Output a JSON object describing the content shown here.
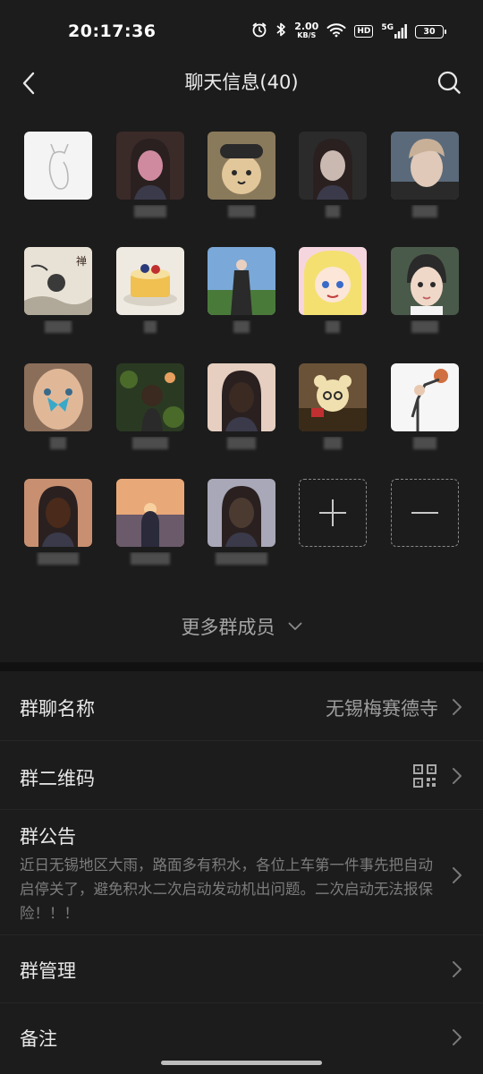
{
  "status_bar": {
    "time": "20:17:36",
    "net_speed_value": "2.00",
    "net_speed_unit": "KB/S",
    "hd_label": "HD",
    "network_label": "5G",
    "battery_level": "30",
    "icons": [
      "alarm-icon",
      "bluetooth-icon",
      "wifi-icon",
      "signal-icon",
      "battery-icon"
    ]
  },
  "header": {
    "title": "聊天信息(40)",
    "back_icon": "back-arrow-icon",
    "search_icon": "search-icon"
  },
  "members": {
    "count": 40,
    "items": [
      {
        "id": "m1",
        "bg": "#f4f4f4",
        "fg": "#b8b8b8",
        "kind": "cat-line"
      },
      {
        "id": "m2",
        "bg": "#3a2a28",
        "fg": "#d08aa0",
        "kind": "anime-dark"
      },
      {
        "id": "m3",
        "bg": "#8a7a5c",
        "fg": "#e2c79a",
        "kind": "cat-hat"
      },
      {
        "id": "m4",
        "bg": "#2b2b2b",
        "fg": "#c9b9b0",
        "kind": "girl-cat"
      },
      {
        "id": "m5",
        "bg": "#5a6a7a",
        "fg": "#e0c9b8",
        "kind": "boy"
      },
      {
        "id": "m6",
        "bg": "#e8e2d6",
        "fg": "#3a3a3a",
        "kind": "ink-painting"
      },
      {
        "id": "m7",
        "bg": "#eeeae2",
        "fg": "#f0c050",
        "kind": "cake"
      },
      {
        "id": "m8",
        "bg": "#7aa8d8",
        "fg": "#2a2a2a",
        "kind": "girl-field"
      },
      {
        "id": "m9",
        "bg": "#f6d6de",
        "fg": "#f4e070",
        "kind": "sailor-moon"
      },
      {
        "id": "m10",
        "bg": "#4a5a4a",
        "fg": "#f0d8c8",
        "kind": "cartoon-face"
      },
      {
        "id": "m11",
        "bg": "#8a6e5a",
        "fg": "#3aa8c8",
        "kind": "butterfly-face"
      },
      {
        "id": "m12",
        "bg": "#2a3a22",
        "fg": "#e8a060",
        "kind": "girl-leaves"
      },
      {
        "id": "m13",
        "bg": "#e6cfc0",
        "fg": "#3a2a22",
        "kind": "drawn-girl"
      },
      {
        "id": "m14",
        "bg": "#6a5238",
        "fg": "#f0e0b0",
        "kind": "bear-toy"
      },
      {
        "id": "m15",
        "bg": "#f6f6f6",
        "fg": "#d07040",
        "kind": "basketball"
      },
      {
        "id": "m16",
        "bg": "#c89070",
        "fg": "#4a2a1a",
        "kind": "woman-portrait"
      },
      {
        "id": "m17",
        "bg": "#e09050",
        "fg": "#2a2a3a",
        "kind": "sunset-person"
      },
      {
        "id": "m18",
        "bg": "#a8a8b8",
        "fg": "#4a3a30",
        "kind": "girl-ponytail"
      }
    ],
    "add_icon": "plus-icon",
    "remove_icon": "minus-icon",
    "more_label": "更多群成员",
    "more_icon": "chevron-down-icon"
  },
  "settings": {
    "group_name_label": "群聊名称",
    "group_name_value": "无锡梅赛德寺",
    "qr_label": "群二维码",
    "qr_icon": "qr-code-icon",
    "notice_label": "群公告",
    "notice_text": "近日无锡地区大雨，路面多有积水，各位上车第一件事先把自动启停关了，避免积水二次启动发动机出问题。二次启动无法报保险！！！",
    "manage_label": "群管理",
    "remark_label": "备注",
    "chevron_icon": "chevron-right-icon"
  }
}
